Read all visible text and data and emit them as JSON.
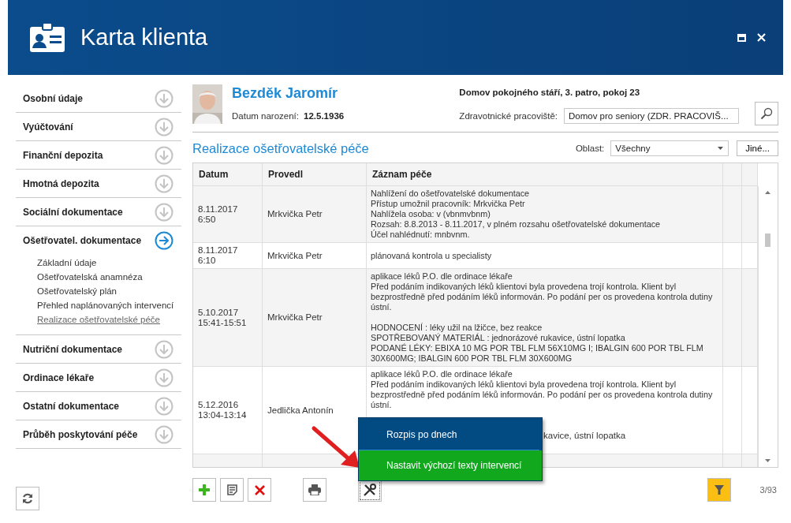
{
  "window": {
    "title": "Karta klienta"
  },
  "sidebar": {
    "sections": [
      {
        "label": "Osobní údaje",
        "expanded": false
      },
      {
        "label": "Vyúčtování",
        "expanded": false
      },
      {
        "label": "Finanční depozita",
        "expanded": false
      },
      {
        "label": "Hmotná depozita",
        "expanded": false
      },
      {
        "label": "Sociální dokumentace",
        "expanded": false
      },
      {
        "label": "Ošetřovatel. dokumentace",
        "expanded": true,
        "children": [
          {
            "label": "Základní údaje",
            "selected": false
          },
          {
            "label": "Ošetřovatelská anamnéza",
            "selected": false
          },
          {
            "label": "Ošetřovatelský plán",
            "selected": false
          },
          {
            "label": "Přehled naplánovaných intervencí",
            "selected": false
          },
          {
            "label": "Realizace ošetřovatelské péče",
            "selected": true
          }
        ]
      },
      {
        "label": "Nutriční dokumentace",
        "expanded": false
      },
      {
        "label": "Ordinace lékaře",
        "expanded": false
      },
      {
        "label": "Ostatní dokumentace",
        "expanded": false
      },
      {
        "label": "Průběh poskytování péče",
        "expanded": false
      }
    ]
  },
  "patient": {
    "name": "Bezděk Jaromír",
    "birth_label": "Datum narození:",
    "birth_date": "12.5.1936",
    "location": "Domov pokojného stáří, 3. patro, pokoj 23",
    "workplace_label": "Zdravotnické pracoviště:",
    "workplace_value": "Domov pro seniory (ZDR. PRACOVIŠ..."
  },
  "section_title": "Realizace ošetřovatelské péče",
  "area": {
    "label": "Oblast:",
    "value": "Všechny"
  },
  "other_button": "Jiné...",
  "table": {
    "columns": [
      "Datum",
      "Provedl",
      "Záznam péče"
    ],
    "rows": [
      {
        "date": [
          "8.11.2017",
          "6:50"
        ],
        "by": "Mrkvička Petr",
        "note": [
          "Nahlížení do ošetřovatelské dokumentace",
          "Přístup umožnil pracovník: Mrkvička Petr",
          "Nahlížela osoba: v (vbnmvbnm)",
          "Rozsah: 8.8.2013 - 8.11.2017, v plném rozsahu ošetřovatelské dokumentace",
          "Účel nahlédnutí: mnbvnm."
        ]
      },
      {
        "date": [
          "8.11.2017",
          "6:10"
        ],
        "by": "Mrkvička Petr",
        "note": [
          "plánovaná kontrola u specialisty"
        ]
      },
      {
        "date": [
          "5.10.2017",
          "15:41-15:51"
        ],
        "by": "Mrkvička Petr",
        "note": [
          "aplikace léků P.O. dle ordinace lékaře",
          "Před podáním indikovaných léků klientovi byla provedena trojí kontrola. Klient byl",
          "bezprostředně před podáním léků informován. Po podání per os provedena kontrola dutiny",
          "ústní."
        ],
        "note_more": [
          "HODNOCENÍ : léky užil na lžičce, bez reakce",
          "SPOTŘEBOVANÝ MATERIÁL : jednorázové rukavice, ústní lopatka",
          "PODANÉ LÉKY: EBIXA 10 MG POR TBL FLM 56X10MG I; IBALGIN 600 POR TBL FLM",
          "30X600MG; IBALGIN 600 POR TBL FLM 30X600MG"
        ]
      },
      {
        "date": [
          "5.12.2016",
          "13:04-13:14"
        ],
        "by": "Jedlička Antonín",
        "note": [
          "aplikace léků P.O. dle ordinace lékaře",
          "Před podáním indikovaných léků klientovi byla provedena trojí kontrola. Klient byl",
          "bezprostředně před podáním léků informován. Po podání per os provedena kontrola dutiny",
          "ústní."
        ],
        "note_tail": "kavice, ústní lopatka"
      }
    ]
  },
  "menu": {
    "items": [
      {
        "label": "Rozpis po dnech",
        "selected": false
      },
      {
        "label": "Nastavit výchozí texty intervencí",
        "selected": true
      }
    ]
  },
  "toolbar": {
    "filter_active": true,
    "counter": "3/93"
  }
}
